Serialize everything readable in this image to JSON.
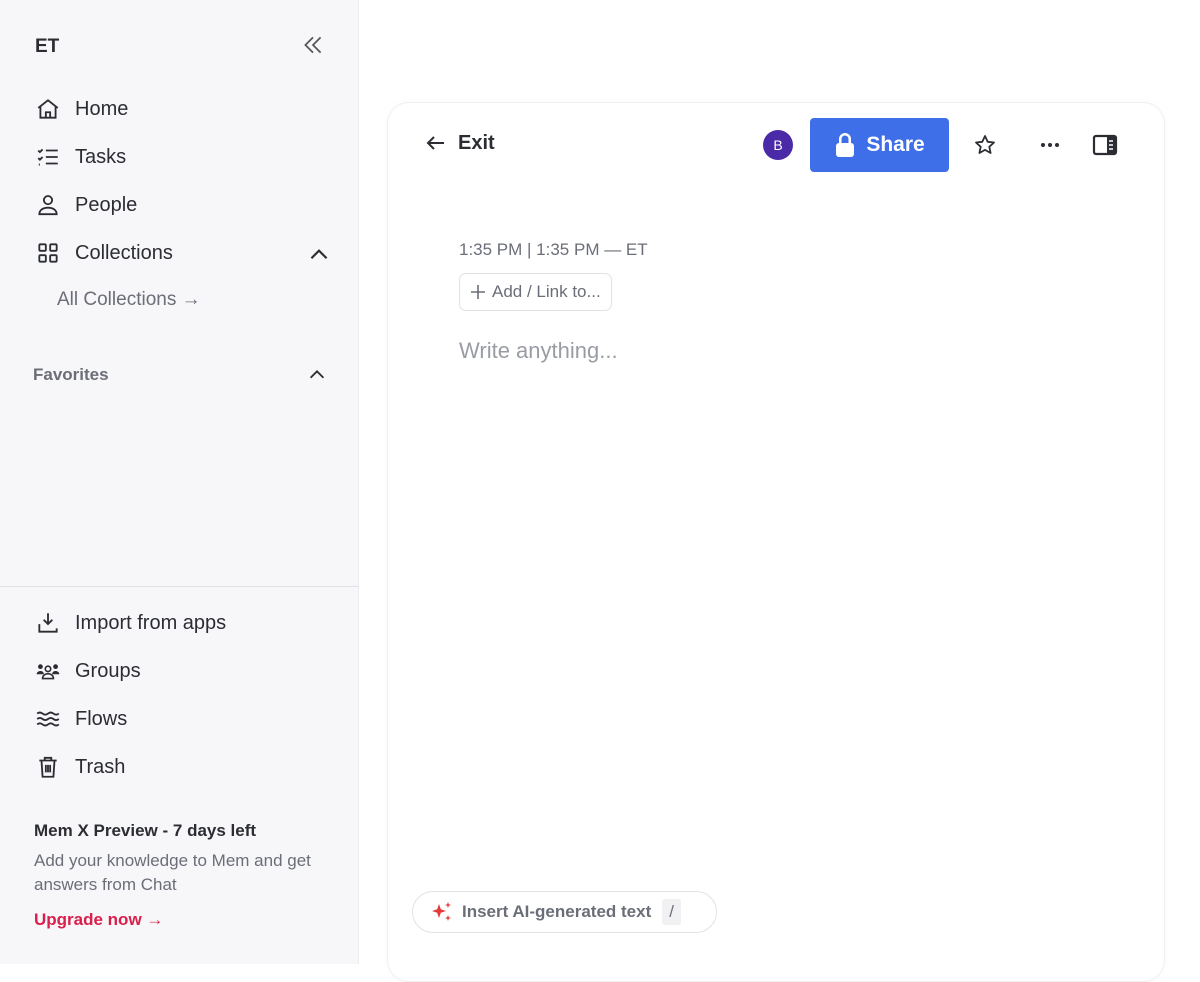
{
  "sidebar": {
    "workspace": "ET",
    "nav": [
      {
        "label": "Home",
        "icon": "home-icon"
      },
      {
        "label": "Tasks",
        "icon": "tasks-icon"
      },
      {
        "label": "People",
        "icon": "person-icon"
      },
      {
        "label": "Collections",
        "icon": "grid-icon"
      }
    ],
    "all_collections": "All Collections →",
    "favorites": "Favorites",
    "bottom_nav": [
      {
        "label": "Import from apps",
        "icon": "import-icon"
      },
      {
        "label": "Groups",
        "icon": "groups-icon"
      },
      {
        "label": "Flows",
        "icon": "waves-icon"
      },
      {
        "label": "Trash",
        "icon": "trash-icon"
      }
    ],
    "promo": {
      "title": "Mem X Preview - 7 days left",
      "text": "Add your knowledge to Mem and get answers from Chat",
      "link": "Upgrade now →",
      "link_color": "#d8204c"
    }
  },
  "editor": {
    "exit": "Exit",
    "avatar": "B",
    "share": "Share",
    "share_color": "#3e6fe8",
    "timestamp": "1:35 PM | 1:35 PM — ET",
    "add_link": "Add / Link to...",
    "placeholder": "Write anything...",
    "ai_button": "Insert AI-generated text",
    "ai_shortcut": "/"
  }
}
